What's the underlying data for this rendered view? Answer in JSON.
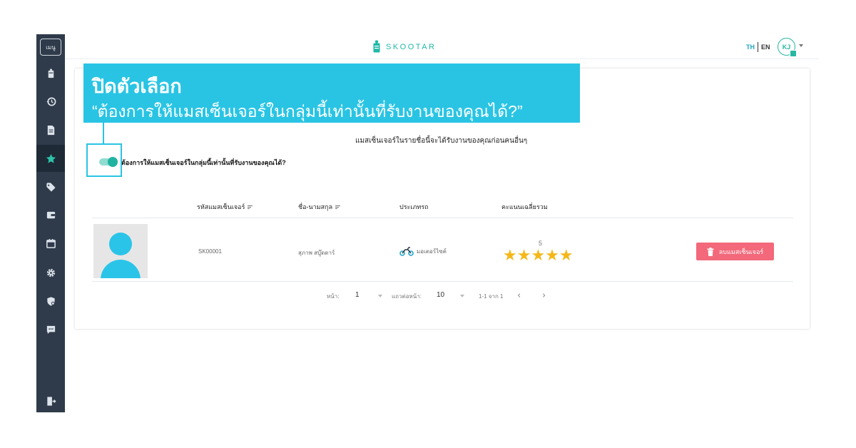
{
  "sidebar": {
    "menu_label": "เมนู",
    "items": [
      {
        "icon": "skootar-icon",
        "active": false
      },
      {
        "icon": "history-icon",
        "active": false
      },
      {
        "icon": "document-icon",
        "active": false
      },
      {
        "icon": "star-icon",
        "active": true
      },
      {
        "icon": "tag-icon",
        "active": false
      },
      {
        "icon": "wallet-icon",
        "active": false
      },
      {
        "icon": "calendar-icon",
        "active": false
      },
      {
        "icon": "gear-icon",
        "active": false
      },
      {
        "icon": "shield-icon",
        "active": false
      },
      {
        "icon": "chat-icon",
        "active": false
      }
    ],
    "logout_icon": "logout-icon"
  },
  "header": {
    "logo_text": "SKOOTAR",
    "lang_th": "TH",
    "lang_en": "EN",
    "avatar_initials": "KJ"
  },
  "overlay": {
    "title": "ปิดตัวเลือก",
    "subtitle": "“ต้องการให้แมสเซ็นเจอร์ในกลุ่มนี้เท่านั้นที่รับงานของคุณได้?”"
  },
  "content": {
    "note": "แมสเซ็นเจอร์ในรายชื่อนี้จะได้รับงานของคุณก่อนคนอื่นๆ",
    "toggle_label": "ต้องการให้แมสเซ็นเจอร์ในกลุ่มนี้เท่านั้นที่รับงานของคุณได้?",
    "toggle_on": true
  },
  "table": {
    "columns": [
      "รหัสแมสเซ็นเจอร์",
      "ชื่อ-นามสกุล",
      "ประเภทรถ",
      "คะแนนเฉลี่ยรวม"
    ],
    "rows": [
      {
        "id": "SK00001",
        "name": "สุภาพ สบู๊ดดาร์",
        "vehicle": "มอเตอร์ไซค์",
        "rating": "5",
        "stars": "★★★★★",
        "remove_label": "ลบแมสเซ็นเจอร์"
      }
    ]
  },
  "pagination": {
    "page_label": "หน้า:",
    "page_value": "1",
    "rows_label": "แถวต่อหน้า:",
    "rows_value": "10",
    "range": "1-1 จาก 1",
    "prev": "‹",
    "next": "›"
  },
  "colors": {
    "sidebar_bg": "#2f3b4b",
    "brand": "#20b9a6",
    "overlay": "#29c4e4",
    "remove": "#f3687a",
    "star": "#f5b81a"
  }
}
